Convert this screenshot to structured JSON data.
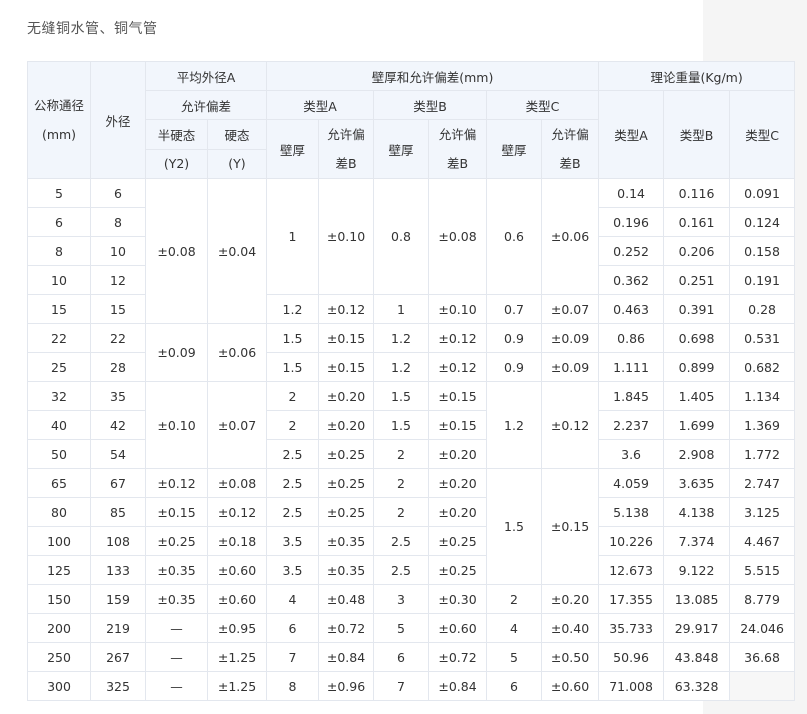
{
  "page_title": "无缝铜水管、铜气管",
  "headers": {
    "nominal_dia_line1": "公称通径",
    "nominal_dia_line2": "(mm)",
    "outer_dia": "外径",
    "avg_outer_dia": "平均外径A",
    "allowed_dev": "允许偏差",
    "half_hard_line1": "半硬态",
    "half_hard_line2": "(Y2)",
    "hard_line1": "硬态",
    "hard_line2": "(Y)",
    "wall_group": "壁厚和允许偏差(mm)",
    "type_a": "类型A",
    "type_b": "类型B",
    "type_c": "类型C",
    "wall": "壁厚",
    "dev_line1": "允许偏",
    "dev_line2": "差B",
    "weight_group": "理论重量(Kg/m)",
    "w_type_a": "类型A",
    "w_type_b": "类型B",
    "w_type_c": "类型C"
  },
  "rows": [
    {
      "dn": "5",
      "od": "6",
      "wA": "0.14",
      "wB": "0.116",
      "wC": "0.091"
    },
    {
      "dn": "6",
      "od": "8",
      "wA": "0.196",
      "wB": "0.161",
      "wC": "0.124"
    },
    {
      "dn": "8",
      "od": "10",
      "wA": "0.252",
      "wB": "0.206",
      "wC": "0.158"
    },
    {
      "dn": "10",
      "od": "12",
      "wA": "0.362",
      "wB": "0.251",
      "wC": "0.191"
    },
    {
      "dn": "15",
      "od": "15",
      "wA": "0.463",
      "wB": "0.391",
      "wC": "0.28"
    },
    {
      "dn": "22",
      "od": "22",
      "wA": "0.86",
      "wB": "0.698",
      "wC": "0.531"
    },
    {
      "dn": "25",
      "od": "28",
      "wA": "1.111",
      "wB": "0.899",
      "wC": "0.682"
    },
    {
      "dn": "32",
      "od": "35",
      "wA": "1.845",
      "wB": "1.405",
      "wC": "1.134"
    },
    {
      "dn": "40",
      "od": "42",
      "wA": "2.237",
      "wB": "1.699",
      "wC": "1.369"
    },
    {
      "dn": "50",
      "od": "54",
      "wA": "3.6",
      "wB": "2.908",
      "wC": "1.772"
    },
    {
      "dn": "65",
      "od": "67",
      "wA": "4.059",
      "wB": "3.635",
      "wC": "2.747"
    },
    {
      "dn": "80",
      "od": "85",
      "wA": "5.138",
      "wB": "4.138",
      "wC": "3.125"
    },
    {
      "dn": "100",
      "od": "108",
      "wA": "10.226",
      "wB": "7.374",
      "wC": "4.467"
    },
    {
      "dn": "125",
      "od": "133",
      "wA": "12.673",
      "wB": "9.122",
      "wC": "5.515"
    },
    {
      "dn": "150",
      "od": "159",
      "wA": "17.355",
      "wB": "13.085",
      "wC": "8.779"
    },
    {
      "dn": "200",
      "od": "219",
      "wA": "35.733",
      "wB": "29.917",
      "wC": "24.046"
    },
    {
      "dn": "250",
      "od": "267",
      "wA": "50.96",
      "wB": "43.848",
      "wC": "36.68"
    },
    {
      "dn": "300",
      "od": "325",
      "wA": "71.008",
      "wB": "63.328",
      "wC": ""
    }
  ],
  "merged": {
    "y2_g1": "±0.08",
    "y_g1": "±0.04",
    "y2_g2": "±0.09",
    "y_g2": "±0.06",
    "y2_g3": "±0.10",
    "y_g3": "±0.07",
    "y2_r65": "±0.12",
    "y_r65": "±0.08",
    "y2_r80": "±0.15",
    "y_r80": "±0.12",
    "y2_r100": "±0.25",
    "y_r100": "±0.18",
    "y2_r125": "±0.35",
    "y_r125": "±0.60",
    "y2_r150": "±0.35",
    "y_r150": "±0.60",
    "y2_r200": "—",
    "y_r200": "±0.95",
    "y2_r250": "—",
    "y_r250": "±1.25",
    "y2_r300": "—",
    "y_r300": "±1.25",
    "aw_g1": "1",
    "ad_g1": "±0.10",
    "bw_g1": "0.8",
    "bd_g1": "±0.08",
    "cw_g1": "0.6",
    "cd_g1": "±0.06",
    "aw_r15": "1.2",
    "ad_r15": "±0.12",
    "bw_r15": "1",
    "bd_r15": "±0.10",
    "cw_r15": "0.7",
    "cd_r15": "±0.07",
    "aw_r22": "1.5",
    "ad_r22": "±0.15",
    "bw_r22": "1.2",
    "bd_r22": "±0.12",
    "cw_r22": "0.9",
    "cd_r22": "±0.09",
    "aw_r25": "1.5",
    "ad_r25": "±0.15",
    "bw_r25": "1.2",
    "bd_r25": "±0.12",
    "cw_r25": "0.9",
    "cd_r25": "±0.09",
    "aw_r32": "2",
    "ad_r32": "±0.20",
    "bw_r32": "1.5",
    "bd_r32": "±0.15",
    "cw_g3": "1.2",
    "cd_g3": "±0.12",
    "aw_r40": "2",
    "ad_r40": "±0.20",
    "bw_r40": "1.5",
    "bd_r40": "±0.15",
    "aw_r50": "2.5",
    "ad_r50": "±0.25",
    "bw_r50": "2",
    "bd_r50": "±0.20",
    "aw_r65": "2.5",
    "ad_r65": "±0.25",
    "bw_r65": "2",
    "bd_r65": "±0.20",
    "cw_g4": "1.5",
    "cd_g4": "±0.15",
    "aw_r80": "2.5",
    "ad_r80": "±0.25",
    "bw_r80": "2",
    "bd_r80": "±0.20",
    "aw_r100": "3.5",
    "ad_r100": "±0.35",
    "bw_r100": "2.5",
    "bd_r100": "±0.25",
    "aw_r125": "3.5",
    "ad_r125": "±0.35",
    "bw_r125": "2.5",
    "bd_r125": "±0.25",
    "aw_r150": "4",
    "ad_r150": "±0.48",
    "bw_r150": "3",
    "bd_r150": "±0.30",
    "cw_r150": "2",
    "cd_r150": "±0.20",
    "aw_r200": "6",
    "ad_r200": "±0.72",
    "bw_r200": "5",
    "bd_r200": "±0.60",
    "cw_r200": "4",
    "cd_r200": "±0.40",
    "aw_r250": "7",
    "ad_r250": "±0.84",
    "bw_r250": "6",
    "bd_r250": "±0.72",
    "cw_r250": "5",
    "cd_r250": "±0.50",
    "aw_r300": "8",
    "ad_r300": "±0.96",
    "bw_r300": "7",
    "bd_r300": "±0.84",
    "cw_r300": "6",
    "cd_r300": "±0.60"
  }
}
